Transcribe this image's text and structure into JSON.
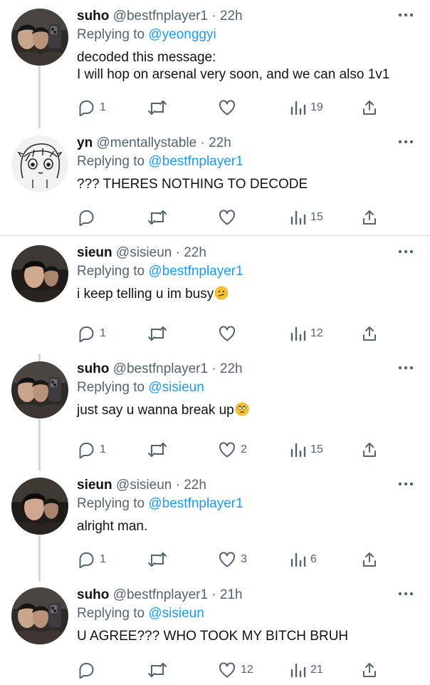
{
  "tweets": [
    {
      "name": "suho",
      "meta": "@bestfnplayer1 · 22h",
      "replying_label": "Replying to",
      "mention": "@yeonggyi",
      "text": "decoded this message:\nI will hop on arsenal very soon, and we can also 1v1",
      "replies": "1",
      "retweets": "",
      "likes": "",
      "views": "19",
      "avatar": "suho",
      "emoji": ""
    },
    {
      "name": "yn",
      "meta": "@mentallystable · 22h",
      "replying_label": "Replying to",
      "mention": "@bestfnplayer1",
      "text": "??? THERES NOTHING TO DECODE",
      "replies": "",
      "retweets": "",
      "likes": "",
      "views": "15",
      "avatar": "yn",
      "emoji": ""
    },
    {
      "name": "sieun",
      "meta": "@sisieun · 22h",
      "replying_label": "Replying to",
      "mention": "@bestfnplayer1",
      "text": "i keep telling u im busy",
      "replies": "1",
      "retweets": "",
      "likes": "",
      "views": "12",
      "avatar": "sieun",
      "emoji": "confused-face"
    },
    {
      "name": "suho",
      "meta": "@bestfnplayer1 · 22h",
      "replying_label": "Replying to",
      "mention": "@sisieun",
      "text": "just say u wanna break up",
      "replies": "1",
      "retweets": "",
      "likes": "2",
      "views": "15",
      "avatar": "suho",
      "emoji": "eye-roll-face"
    },
    {
      "name": "sieun",
      "meta": "@sisieun · 22h",
      "replying_label": "Replying to",
      "mention": "@bestfnplayer1",
      "text": "alright man.",
      "replies": "1",
      "retweets": "",
      "likes": "3",
      "views": "6",
      "avatar": "sieun",
      "emoji": ""
    },
    {
      "name": "suho",
      "meta": "@bestfnplayer1 · 21h",
      "replying_label": "Replying to",
      "mention": "@sisieun",
      "text": "U AGREE??? WHO TOOK MY BITCH BRUH",
      "replies": "",
      "retweets": "",
      "likes": "12",
      "views": "21",
      "avatar": "suho",
      "emoji": ""
    }
  ],
  "colors": {
    "text": "#0f1419",
    "secondary": "#536471",
    "link": "#1d9bf0",
    "divider": "#cfd9de"
  },
  "icons": {
    "reply": "reply-icon",
    "retweet": "retweet-icon",
    "like": "heart-icon",
    "views": "views-icon",
    "share": "share-icon",
    "more": "more-icon"
  }
}
